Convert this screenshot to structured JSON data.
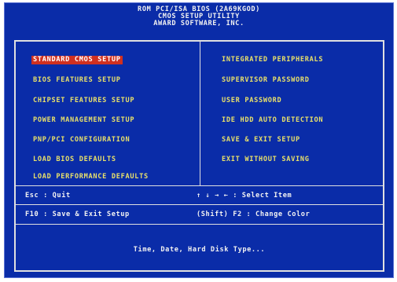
{
  "header": {
    "line1": "ROM PCI/ISA BIOS (2A69KGOD)",
    "line2": "CMOS SETUP UTILITY",
    "line3": "AWARD SOFTWARE,  INC."
  },
  "menu": {
    "left": [
      {
        "label": "STANDARD CMOS SETUP",
        "selected": true
      },
      {
        "label": "BIOS FEATURES SETUP"
      },
      {
        "label": "CHIPSET FEATURES SETUP"
      },
      {
        "label": "POWER MANAGEMENT SETUP"
      },
      {
        "label": "PNP/PCI CONFIGURATION"
      },
      {
        "label": "LOAD BIOS DEFAULTS"
      },
      {
        "label": "LOAD PERFORMANCE DEFAULTS"
      }
    ],
    "right": [
      {
        "label": "INTEGRATED PERIPHERALS"
      },
      {
        "label": "SUPERVISOR PASSWORD"
      },
      {
        "label": "USER PASSWORD"
      },
      {
        "label": "IDE HDD AUTO DETECTION"
      },
      {
        "label": "SAVE & EXIT SETUP"
      },
      {
        "label": "EXIT WITHOUT SAVING"
      }
    ]
  },
  "help": {
    "esc": "Esc : Quit",
    "arrows": "↑ ↓ → ← : Select Item",
    "f10": "F10 : Save & Exit Setup",
    "shift_f2": "(Shift) F2 : Change Color"
  },
  "status": "Time, Date, Hard Disk Type...",
  "colors": {
    "background": "#0a2ca8",
    "menu_text": "#e8e06a",
    "highlight": "#d03020",
    "border": "#e0e0e0"
  }
}
